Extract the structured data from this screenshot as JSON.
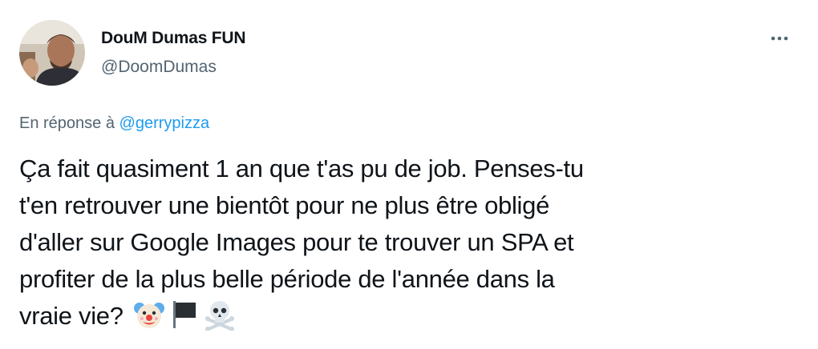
{
  "author": {
    "display_name": "DouM Dumas FUN",
    "handle": "@DoomDumas"
  },
  "menu": {
    "icon": "more-horizontal-icon"
  },
  "reply": {
    "prefix": "En réponse à ",
    "mention": "@gerrypizza"
  },
  "tweet": {
    "lines": [
      "Ça fait quasiment 1 an que t'as pu de job. Penses-tu",
      "t'en retrouver une bientôt pour ne plus être obligé",
      "d'aller sur Google Images pour te trouver un SPA et",
      "profiter de la plus belle période de l'année dans la",
      "vraie vie?"
    ],
    "emojis": [
      "clown-face-icon",
      "black-flag-icon",
      "skull-and-crossbones-icon"
    ]
  },
  "colors": {
    "text": "#0f1419",
    "secondary": "#536471",
    "link": "#1d9bf0",
    "background": "#ffffff"
  }
}
